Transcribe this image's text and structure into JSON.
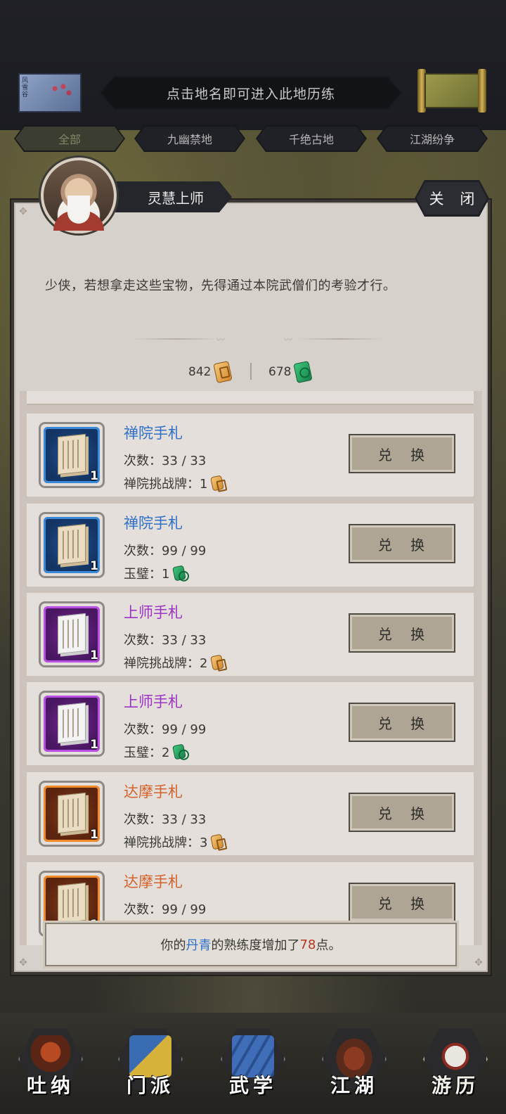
{
  "header": {
    "region_thumb_label": "风雪谷",
    "hint": "点击地名即可进入此地历练",
    "scroll_icon": "map-scroll-icon"
  },
  "tabs": [
    {
      "label": "全部",
      "active": true
    },
    {
      "label": "九幽禁地",
      "active": false
    },
    {
      "label": "千绝古地",
      "active": false
    },
    {
      "label": "江湖纷争",
      "active": false
    }
  ],
  "npc": {
    "name": "灵慧上师",
    "dialogue": "少侠，若想拿走这些宝物，先得通过本院武僧们的考验才行。"
  },
  "close_label": "关 闭",
  "currencies": [
    {
      "value": "842",
      "icon": "gold-token-icon",
      "color": "#e0a347"
    },
    {
      "value": "678",
      "icon": "jade-token-icon",
      "color": "#1f9b57"
    }
  ],
  "exchange_label": "兑 换",
  "items": [
    {
      "name": "禅院手札",
      "rarity": "blue",
      "qty": "1",
      "count": "次数：33 / 33",
      "cost_label": "禅院挑战牌：1",
      "cost_icon": "gold"
    },
    {
      "name": "禅院手札",
      "rarity": "blue",
      "qty": "1",
      "count": "次数：99 / 99",
      "cost_label": "玉璧：1",
      "cost_icon": "jade"
    },
    {
      "name": "上师手札",
      "rarity": "purple",
      "qty": "1",
      "count": "次数：33 / 33",
      "cost_label": "禅院挑战牌：2",
      "cost_icon": "gold"
    },
    {
      "name": "上师手札",
      "rarity": "purple",
      "qty": "1",
      "count": "次数：99 / 99",
      "cost_label": "玉璧：2",
      "cost_icon": "jade"
    },
    {
      "name": "达摩手札",
      "rarity": "orange",
      "qty": "1",
      "count": "次数：33 / 33",
      "cost_label": "禅院挑战牌：3",
      "cost_icon": "gold"
    },
    {
      "name": "达摩手札",
      "rarity": "orange",
      "qty": "1",
      "count": "次数：99 / 99",
      "cost_label": "",
      "cost_icon": ""
    }
  ],
  "toast": {
    "prefix": "你的",
    "skill": "丹青",
    "middle": "的熟练度增加了",
    "amount": "78",
    "suffix": "点。"
  },
  "bottom_nav": [
    {
      "label": "吐纳",
      "icon": "meditation-icon"
    },
    {
      "label": "门派",
      "icon": "sect-icon"
    },
    {
      "label": "武学",
      "icon": "martial-books-icon"
    },
    {
      "label": "江湖",
      "icon": "jianghu-hat-icon"
    },
    {
      "label": "游历",
      "icon": "horse-travel-icon",
      "active": true
    }
  ]
}
